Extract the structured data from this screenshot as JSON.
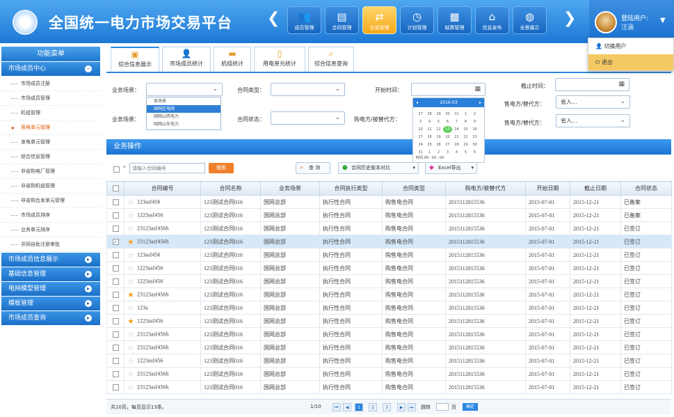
{
  "header": {
    "title": "全国统一电力市场交易平台",
    "nav": [
      {
        "label": "成员管理",
        "icon": "members-icon",
        "active": false
      },
      {
        "label": "合同管理",
        "icon": "contract-icon",
        "active": false
      },
      {
        "label": "交易管理",
        "icon": "trade-icon",
        "active": true
      },
      {
        "label": "计划管理",
        "icon": "clock-icon",
        "active": false
      },
      {
        "label": "结算管理",
        "icon": "calculator-icon",
        "active": false
      },
      {
        "label": "信息发布",
        "icon": "house-icon",
        "active": false
      },
      {
        "label": "全景展示",
        "icon": "globe-icon",
        "active": false
      }
    ],
    "user_label": "登陆用户:",
    "user_name": "汪涵",
    "user_menu": [
      "切换用户",
      "退出"
    ]
  },
  "sidebar": {
    "title": "功能菜单",
    "section1": "市场成员中心",
    "items": [
      "市场成员注册",
      "市场成员管理",
      "机组管理",
      "用电单元管理",
      "发电单元管理",
      "综合信息管理",
      "非省购电厂管理",
      "非省购机组管理",
      "非省购合发单元管理",
      "市场成员排序",
      "业务单元排序",
      "并网自助注册审批"
    ],
    "active_index": 3,
    "sections": [
      "市场成员信息展示",
      "基础信息管理",
      "电网模型管理",
      "模板管理",
      "市场成员查询"
    ]
  },
  "tabs": [
    "综合信息展示",
    "市场成员统计",
    "机组统计",
    "用电单元统计",
    "综合信息查询"
  ],
  "filters": {
    "biz_scene": "业务场景：",
    "contract_type": "合同类型：",
    "start_time": "开始时间：",
    "end_time": "截止时间：",
    "biz_scene2": "业务场景：",
    "contract_status": "合同状态：",
    "buyer": "购电方/被替代方：",
    "seller": "售电方/替代方：",
    "seller2": "售电方/替代方：",
    "seller_val": "省入...",
    "seller2_val": "省入...",
    "dd_options": [
      "本场景",
      "国网区电网",
      "国网山西电力",
      "国网山东电力"
    ]
  },
  "calendar": {
    "title": "2016-03",
    "time": "00 : 00 : 00"
  },
  "ops": {
    "title": "业务操作",
    "search_placeholder": "请输入合同编号",
    "search_btn": "搜索",
    "query_btn": "查 询",
    "status_btn": "合同历史版本对比",
    "excel_btn": "Excel导出"
  },
  "table": {
    "columns": [
      "",
      "合同编号",
      "合同名称",
      "业务场景",
      "合同执行类型",
      "合同类型",
      "购电方/被替代方",
      "开始日期",
      "截止日期",
      "合同状态"
    ],
    "rows": [
      {
        "no": "123asf456",
        "name": "123测试合同016",
        "scene": "国网总部",
        "exec": "执行性合同",
        "type": "购售电合同",
        "party": "2015112815536",
        "start": "2015-07-01",
        "end": "2015-12-21",
        "status": "已备案",
        "star": false,
        "checked": false
      },
      {
        "no": "1223asf456",
        "name": "123测试合同016",
        "scene": "国网总部",
        "exec": "执行性合同",
        "type": "购售电合同",
        "party": "2015112815536",
        "start": "2015-07-01",
        "end": "2015-12-21",
        "status": "已备案",
        "star": false,
        "checked": false
      },
      {
        "no": "23123asf456h",
        "name": "123测试合同016",
        "scene": "国网总部",
        "exec": "执行性合同",
        "type": "购售电合同",
        "party": "2015112815536",
        "start": "2015-07-01",
        "end": "2015-12-21",
        "status": "已签订",
        "star": false,
        "checked": false
      },
      {
        "no": "23123asf456h",
        "name": "123测试合同016",
        "scene": "国网总部",
        "exec": "执行性合同",
        "type": "购售电合同",
        "party": "2015112815536",
        "start": "2015-07-01",
        "end": "2015-12-21",
        "status": "已签订",
        "star": true,
        "checked": true
      },
      {
        "no": "123asf456",
        "name": "123测试合同016",
        "scene": "国网总部",
        "exec": "执行性合同",
        "type": "购售电合同",
        "party": "2015112815536",
        "start": "2015-07-01",
        "end": "2015-12-21",
        "status": "已签订",
        "star": false,
        "checked": false
      },
      {
        "no": "1223asf456",
        "name": "123测试合同016",
        "scene": "国网总部",
        "exec": "执行性合同",
        "type": "购售电合同",
        "party": "2015112815536",
        "start": "2015-07-01",
        "end": "2015-12-21",
        "status": "已签订",
        "star": false,
        "checked": false
      },
      {
        "no": "1223asf456",
        "name": "123测试合同016",
        "scene": "国网总部",
        "exec": "执行性合同",
        "type": "购售电合同",
        "party": "2015112815536",
        "start": "2015-07-01",
        "end": "2015-12-21",
        "status": "已签订",
        "star": false,
        "checked": false
      },
      {
        "no": "23123asf456h",
        "name": "123测试合同016",
        "scene": "国网总部",
        "exec": "执行性合同",
        "type": "购售电合同",
        "party": "2015112815536",
        "start": "2015-07-01",
        "end": "2015-12-21",
        "status": "已签订",
        "star": true,
        "checked": false
      },
      {
        "no": "123a",
        "name": "123测试合同016",
        "scene": "国网总部",
        "exec": "执行性合同",
        "type": "购售电合同",
        "party": "2015112815536",
        "start": "2015-07-01",
        "end": "2015-12-21",
        "status": "已签订",
        "star": false,
        "checked": false
      },
      {
        "no": "1223asf456",
        "name": "123测试合同016",
        "scene": "国网总部",
        "exec": "执行性合同",
        "type": "购售电合同",
        "party": "2015112815536",
        "start": "2015-07-01",
        "end": "2015-12-21",
        "status": "已签订",
        "star": true,
        "checked": false
      },
      {
        "no": "23123asf456h",
        "name": "123测试合同016",
        "scene": "国网总部",
        "exec": "执行性合同",
        "type": "购售电合同",
        "party": "2015112815536",
        "start": "2015-07-01",
        "end": "2015-12-21",
        "status": "已签订",
        "star": false,
        "checked": false
      },
      {
        "no": "23123asf456h",
        "name": "123测试合同016",
        "scene": "国网总部",
        "exec": "执行性合同",
        "type": "购售电合同",
        "party": "2015112815536",
        "start": "2015-07-01",
        "end": "2015-12-21",
        "status": "已签订",
        "star": false,
        "checked": false
      },
      {
        "no": "1223asf456",
        "name": "123测试合同016",
        "scene": "国网总部",
        "exec": "执行性合同",
        "type": "购售电合同",
        "party": "2015112815536",
        "start": "2015-07-01",
        "end": "2015-12-21",
        "status": "已签订",
        "star": false,
        "checked": false
      },
      {
        "no": "23123asf456h",
        "name": "123测试合同016",
        "scene": "国网总部",
        "exec": "执行性合同",
        "type": "购售电合同",
        "party": "2015112815536",
        "start": "2015-07-01",
        "end": "2015-12-21",
        "status": "已签订",
        "star": false,
        "checked": false
      },
      {
        "no": "23123asf456h",
        "name": "123测试合同016",
        "scene": "国网总部",
        "exec": "执行性合同",
        "type": "购售电合同",
        "party": "2015112815536",
        "start": "2015-07-01",
        "end": "2015-12-21",
        "status": "已签订",
        "star": false,
        "checked": false
      }
    ]
  },
  "pager": {
    "info": "共10页，每页显示13条。",
    "page": "1/10",
    "pages": [
      "1",
      "2",
      "3"
    ],
    "jump_label": "跳转",
    "jump_unit": "页",
    "go": "确定"
  },
  "colors": {
    "primary": "#1d78d6",
    "accent": "#f5a819",
    "highlight_row": "#d6e8fa"
  }
}
